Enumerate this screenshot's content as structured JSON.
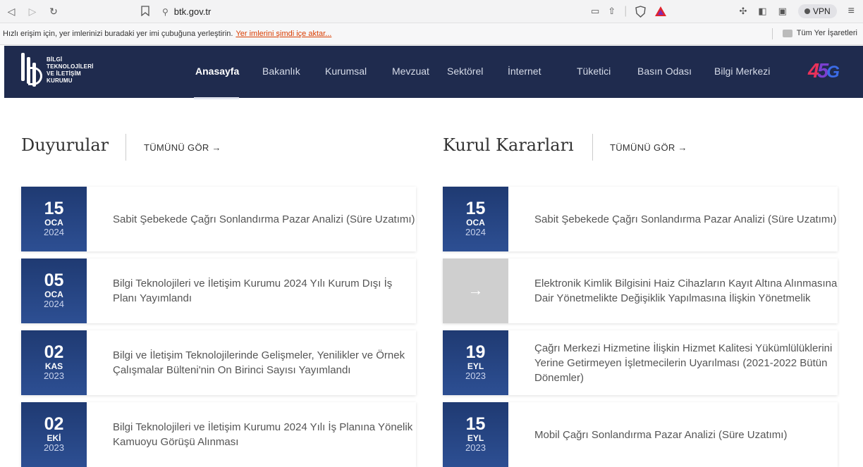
{
  "browser": {
    "url": "btk.gov.tr",
    "vpn_label": "VPN",
    "bookmark_message": "Hızlı erişim için, yer imlerinizi buradaki yer imi çubuğuna yerleştirin.",
    "bookmark_import": "Yer imlerini şimdi içe aktar...",
    "all_bookmarks": "Tüm Yer İşaretleri"
  },
  "site": {
    "logo_lines": [
      "BİLGİ",
      "TEKNOLOJİLERİ",
      "VE İLETİŞİM",
      "KURUMU"
    ],
    "menu": [
      "Anasayfa",
      "Bakanlık",
      "Kurumsal",
      "Mevzuat",
      "Sektörel",
      "İnternet",
      "Tüketici",
      "Basın Odası",
      "Bilgi Merkezi"
    ],
    "logo45": {
      "four": "4",
      "five": "5",
      "g": "G"
    }
  },
  "duyurular": {
    "title": "Duyurular",
    "see_all": "TÜMÜNÜ GÖR →",
    "items": [
      {
        "day": "15",
        "month": "OCA",
        "year": "2024",
        "text": "Sabit Şebekede Çağrı Sonlandırma Pazar Analizi (Süre Uzatımı)"
      },
      {
        "day": "05",
        "month": "OCA",
        "year": "2024",
        "text": "Bilgi Teknolojileri ve İletişim Kurumu 2024 Yılı Kurum Dışı İş Planı Yayımlandı"
      },
      {
        "day": "02",
        "month": "KAS",
        "year": "2023",
        "text": "Bilgi ve İletişim Teknolojilerinde Gelişmeler, Yenilikler ve Örnek Çalışmalar Bülteni'nin On Birinci Sayısı Yayımlandı"
      },
      {
        "day": "02",
        "month": "EKİ",
        "year": "2023",
        "text": "Bilgi Teknolojileri ve İletişim Kurumu 2024 Yılı İş Planına Yönelik Kamuoyu Görüşü Alınması"
      }
    ]
  },
  "kurul": {
    "title": "Kurul Kararları",
    "see_all": "TÜMÜNÜ GÖR →",
    "items": [
      {
        "day": "15",
        "month": "OCA",
        "year": "2024",
        "text": "Sabit Şebekede Çağrı Sonlandırma Pazar Analizi (Süre Uzatımı)"
      },
      {
        "arrow": "→",
        "text": "Elektronik Kimlik Bilgisini Haiz Cihazların Kayıt Altına Alınmasına Dair Yönetmelikte Değişiklik Yapılmasına İlişkin Yönetmelik"
      },
      {
        "day": "19",
        "month": "EYL",
        "year": "2023",
        "text": "Çağrı Merkezi Hizmetine İlişkin Hizmet Kalitesi Yükümlülüklerini Yerine Getirmeyen İşletmecilerin Uyarılması (2021-2022 Bütün Dönemler)"
      },
      {
        "day": "15",
        "month": "EYL",
        "year": "2023",
        "text": "Mobil Çağrı Sonlandırma Pazar Analizi (Süre Uzatımı)"
      }
    ]
  }
}
